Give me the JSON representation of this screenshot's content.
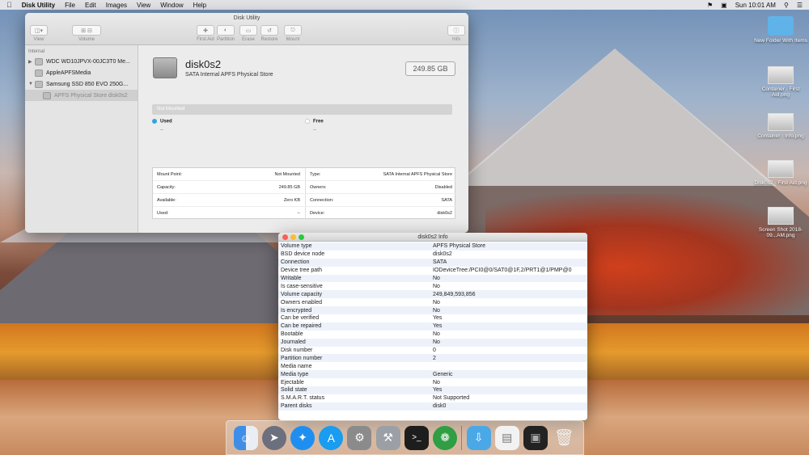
{
  "menubar": {
    "app": "Disk Utility",
    "items": [
      "File",
      "Edit",
      "Images",
      "View",
      "Window",
      "Help"
    ],
    "clock": "Sun 10:01 AM"
  },
  "disk_utility": {
    "window_title": "Disk Utility",
    "toolbar": {
      "view": "View",
      "volume": "Volume",
      "first_aid": "First Aid",
      "partition": "Partition",
      "erase": "Erase",
      "restore": "Restore",
      "mount": "Mount",
      "info": "Info"
    },
    "sidebar": {
      "section": "Internal",
      "items": [
        "WDC WD10JPVX-00JC3T0 Me...",
        "AppleAPFSMedia",
        "Samsung SSD 850 EVO 250G...",
        "APFS Physical Store disk0s2"
      ]
    },
    "disk": {
      "name": "disk0s2",
      "subtitle": "SATA Internal APFS Physical Store",
      "size": "249.85 GB"
    },
    "usage": {
      "bar_label": "Not Mounted",
      "used_label": "Used",
      "used_value": "--",
      "free_label": "Free",
      "free_value": "--",
      "used_color": "#2ea6dc"
    },
    "props_left": [
      {
        "k": "Mount Point:",
        "v": "Not Mounted"
      },
      {
        "k": "Capacity:",
        "v": "249.85 GB"
      },
      {
        "k": "Available:",
        "v": "Zero KB"
      },
      {
        "k": "Used:",
        "v": "--"
      }
    ],
    "props_right": [
      {
        "k": "Type:",
        "v": "SATA Internal APFS Physical Store"
      },
      {
        "k": "Owners:",
        "v": "Disabled"
      },
      {
        "k": "Connection:",
        "v": "SATA"
      },
      {
        "k": "Device:",
        "v": "disk0s2"
      }
    ]
  },
  "info_window": {
    "title": "disk0s2 Info",
    "rows": [
      {
        "k": "Volume type",
        "v": "APFS Physical Store"
      },
      {
        "k": "BSD device node",
        "v": "disk0s2"
      },
      {
        "k": "Connection",
        "v": "SATA"
      },
      {
        "k": "Device tree path",
        "v": "IODeviceTree:/PCI0@0/SAT0@1F,2/PRT1@1/PMP@0"
      },
      {
        "k": "Writable",
        "v": "No"
      },
      {
        "k": "Is case-sensitive",
        "v": "No"
      },
      {
        "k": "Volume capacity",
        "v": "249,849,593,856"
      },
      {
        "k": "Owners enabled",
        "v": "No"
      },
      {
        "k": "Is encrypted",
        "v": "No"
      },
      {
        "k": "Can be verified",
        "v": "Yes"
      },
      {
        "k": "Can be repaired",
        "v": "Yes"
      },
      {
        "k": "Bootable",
        "v": "No"
      },
      {
        "k": "Journaled",
        "v": "No"
      },
      {
        "k": "Disk number",
        "v": "0"
      },
      {
        "k": "Partition number",
        "v": "2"
      },
      {
        "k": "Media name",
        "v": ""
      },
      {
        "k": "Media type",
        "v": "Generic"
      },
      {
        "k": "Ejectable",
        "v": "No"
      },
      {
        "k": "Solid state",
        "v": "Yes"
      },
      {
        "k": "S.M.A.R.T. status",
        "v": "Not Supported"
      },
      {
        "k": "Parent disks",
        "v": "disk0"
      }
    ]
  },
  "desktop_icons": [
    "New Folder With Items",
    "Container - First Aid.png",
    "Container - Info.png",
    "Disk0s2 - First Aid.png",
    "Screen Shot 2018-09...AM.png"
  ]
}
